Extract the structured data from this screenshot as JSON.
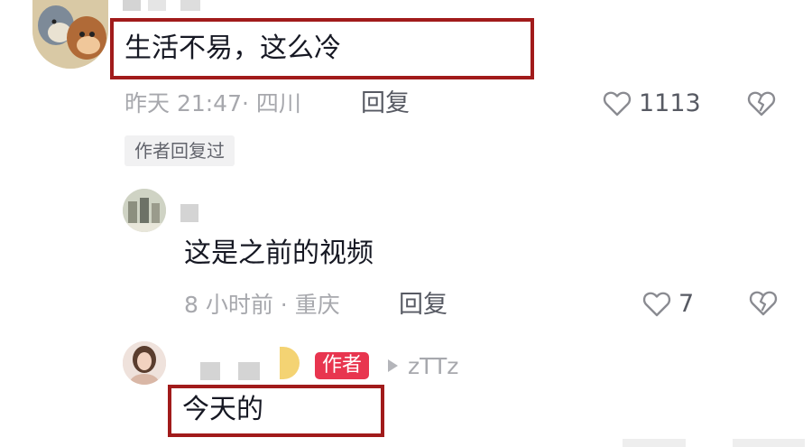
{
  "comments": [
    {
      "text": "生活不易，这么冷",
      "meta": "昨天 21:47· 四川",
      "reply_label": "回复",
      "like_count": "1113",
      "author_replied_tag": "作者回复过"
    },
    {
      "text": "这是之前的视频",
      "meta": "8 小时前 · 重庆",
      "reply_label": "回复",
      "like_count": "7"
    },
    {
      "text": "今天的",
      "author_badge": "作者",
      "reply_to": "zTTz"
    }
  ],
  "colors": {
    "highlight_border": "#a11b1b",
    "author_badge": "#e8354f"
  },
  "icons": [
    "heart-outline-icon",
    "broken-heart-icon",
    "reply-arrow-icon"
  ]
}
